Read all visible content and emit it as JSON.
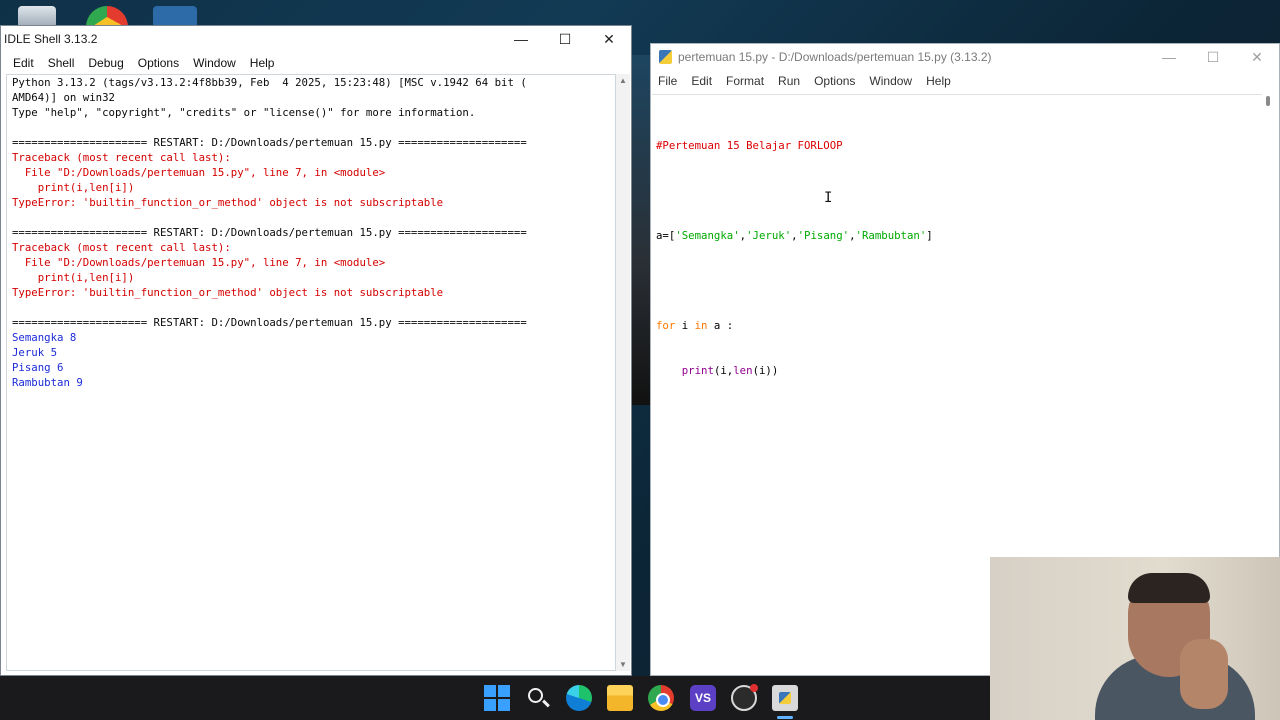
{
  "shell": {
    "title": "IDLE Shell 3.13.2",
    "controls": {
      "minimize": "—",
      "maximize": "☐",
      "close": "✕"
    },
    "menu": [
      "Edit",
      "Shell",
      "Debug",
      "Options",
      "Window",
      "Help"
    ],
    "lines": [
      {
        "text": "Python 3.13.2 (tags/v3.13.2:4f8bb39, Feb  4 2025, 15:23:48) [MSC v.1942 64 bit (",
        "kind": "out"
      },
      {
        "text": "AMD64)] on win32",
        "kind": "out"
      },
      {
        "text": "Type \"help\", \"copyright\", \"credits\" or \"license()\" for more information.",
        "kind": "out"
      },
      {
        "text": "",
        "kind": "out"
      },
      {
        "text": "===================== RESTART: D:/Downloads/pertemuan 15.py ====================",
        "kind": "restart"
      },
      {
        "text": "Traceback (most recent call last):",
        "kind": "err"
      },
      {
        "text": "  File \"D:/Downloads/pertemuan 15.py\", line 7, in <module>",
        "kind": "err"
      },
      {
        "text": "    print(i,len[i])",
        "kind": "err"
      },
      {
        "text": "TypeError: 'builtin_function_or_method' object is not subscriptable",
        "kind": "err"
      },
      {
        "text": "",
        "kind": "out"
      },
      {
        "text": "===================== RESTART: D:/Downloads/pertemuan 15.py ====================",
        "kind": "restart"
      },
      {
        "text": "Traceback (most recent call last):",
        "kind": "err"
      },
      {
        "text": "  File \"D:/Downloads/pertemuan 15.py\", line 7, in <module>",
        "kind": "err"
      },
      {
        "text": "    print(i,len[i])",
        "kind": "err"
      },
      {
        "text": "TypeError: 'builtin_function_or_method' object is not subscriptable",
        "kind": "err"
      },
      {
        "text": "",
        "kind": "out"
      },
      {
        "text": "===================== RESTART: D:/Downloads/pertemuan 15.py ====================",
        "kind": "restart"
      },
      {
        "text": "Semangka 8",
        "kind": "stdout"
      },
      {
        "text": "Jeruk 5",
        "kind": "stdout"
      },
      {
        "text": "Pisang 6",
        "kind": "stdout"
      },
      {
        "text": "Rambubtan 9",
        "kind": "stdout"
      }
    ]
  },
  "editor": {
    "title": "pertemuan 15.py - D:/Downloads/pertemuan 15.py (3.13.2)",
    "controls": {
      "minimize": "—",
      "maximize": "☐",
      "close": "✕"
    },
    "menu": [
      "File",
      "Edit",
      "Format",
      "Run",
      "Options",
      "Window",
      "Help"
    ],
    "code": {
      "comment": "#Pertemuan 15 Belajar FORLOOP",
      "assign_prefix": "a=[",
      "items": [
        "'Semangka'",
        "'Jeruk'",
        "'Pisang'",
        "'Rambubtan'"
      ],
      "separator": ",",
      "assign_suffix": "]",
      "for_kw": "for",
      "for_mid": " i ",
      "in_kw": "in",
      "for_end": " a :",
      "indent": "    ",
      "print_kw": "print",
      "print_mid": "(i,",
      "len_kw": "len",
      "print_end": "(i))"
    }
  },
  "taskbar": {
    "apps": [
      "start-icon",
      "search-icon",
      "edge-icon",
      "file-explorer-icon",
      "chrome-icon",
      "visual-studio-icon",
      "obs-icon",
      "idle-icon"
    ],
    "vs_label": "VS"
  },
  "colors": {
    "keyword": "#ff7700",
    "comment": "#dd0000",
    "string": "#00aa00",
    "builtin": "#900090",
    "error": "#d40000",
    "stdout": "#1b2bd8"
  }
}
